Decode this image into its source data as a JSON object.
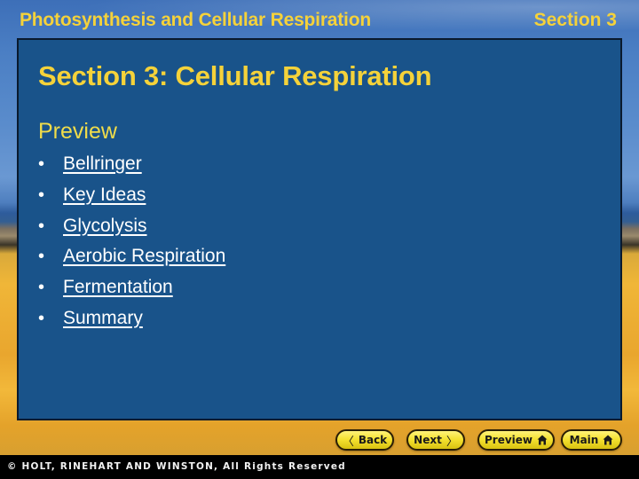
{
  "header": {
    "title": "Photosynthesis and Cellular Respiration",
    "section": "Section 3"
  },
  "slide": {
    "title": "Section 3: Cellular Respiration",
    "subtitle": "Preview",
    "bullet_glyph": "•",
    "items": [
      {
        "label": "Bellringer"
      },
      {
        "label": "Key Ideas"
      },
      {
        "label": "Glycolysis"
      },
      {
        "label": "Aerobic Respiration"
      },
      {
        "label": "Fermentation"
      },
      {
        "label": "Summary"
      }
    ]
  },
  "navigation": {
    "back_label": "Back",
    "next_label": "Next",
    "preview_label": "Preview",
    "main_label": "Main",
    "back_icon": "chevron-left-icon",
    "next_icon": "chevron-right-icon",
    "home_icon": "home-icon"
  },
  "footer": {
    "copyright": "© HOLT, RINEHART AND WINSTON, All Rights Reserved"
  },
  "colors": {
    "title_yellow": "#f5d23a",
    "panel_blue": "#19538a",
    "button_yellow": "#f5e232"
  }
}
